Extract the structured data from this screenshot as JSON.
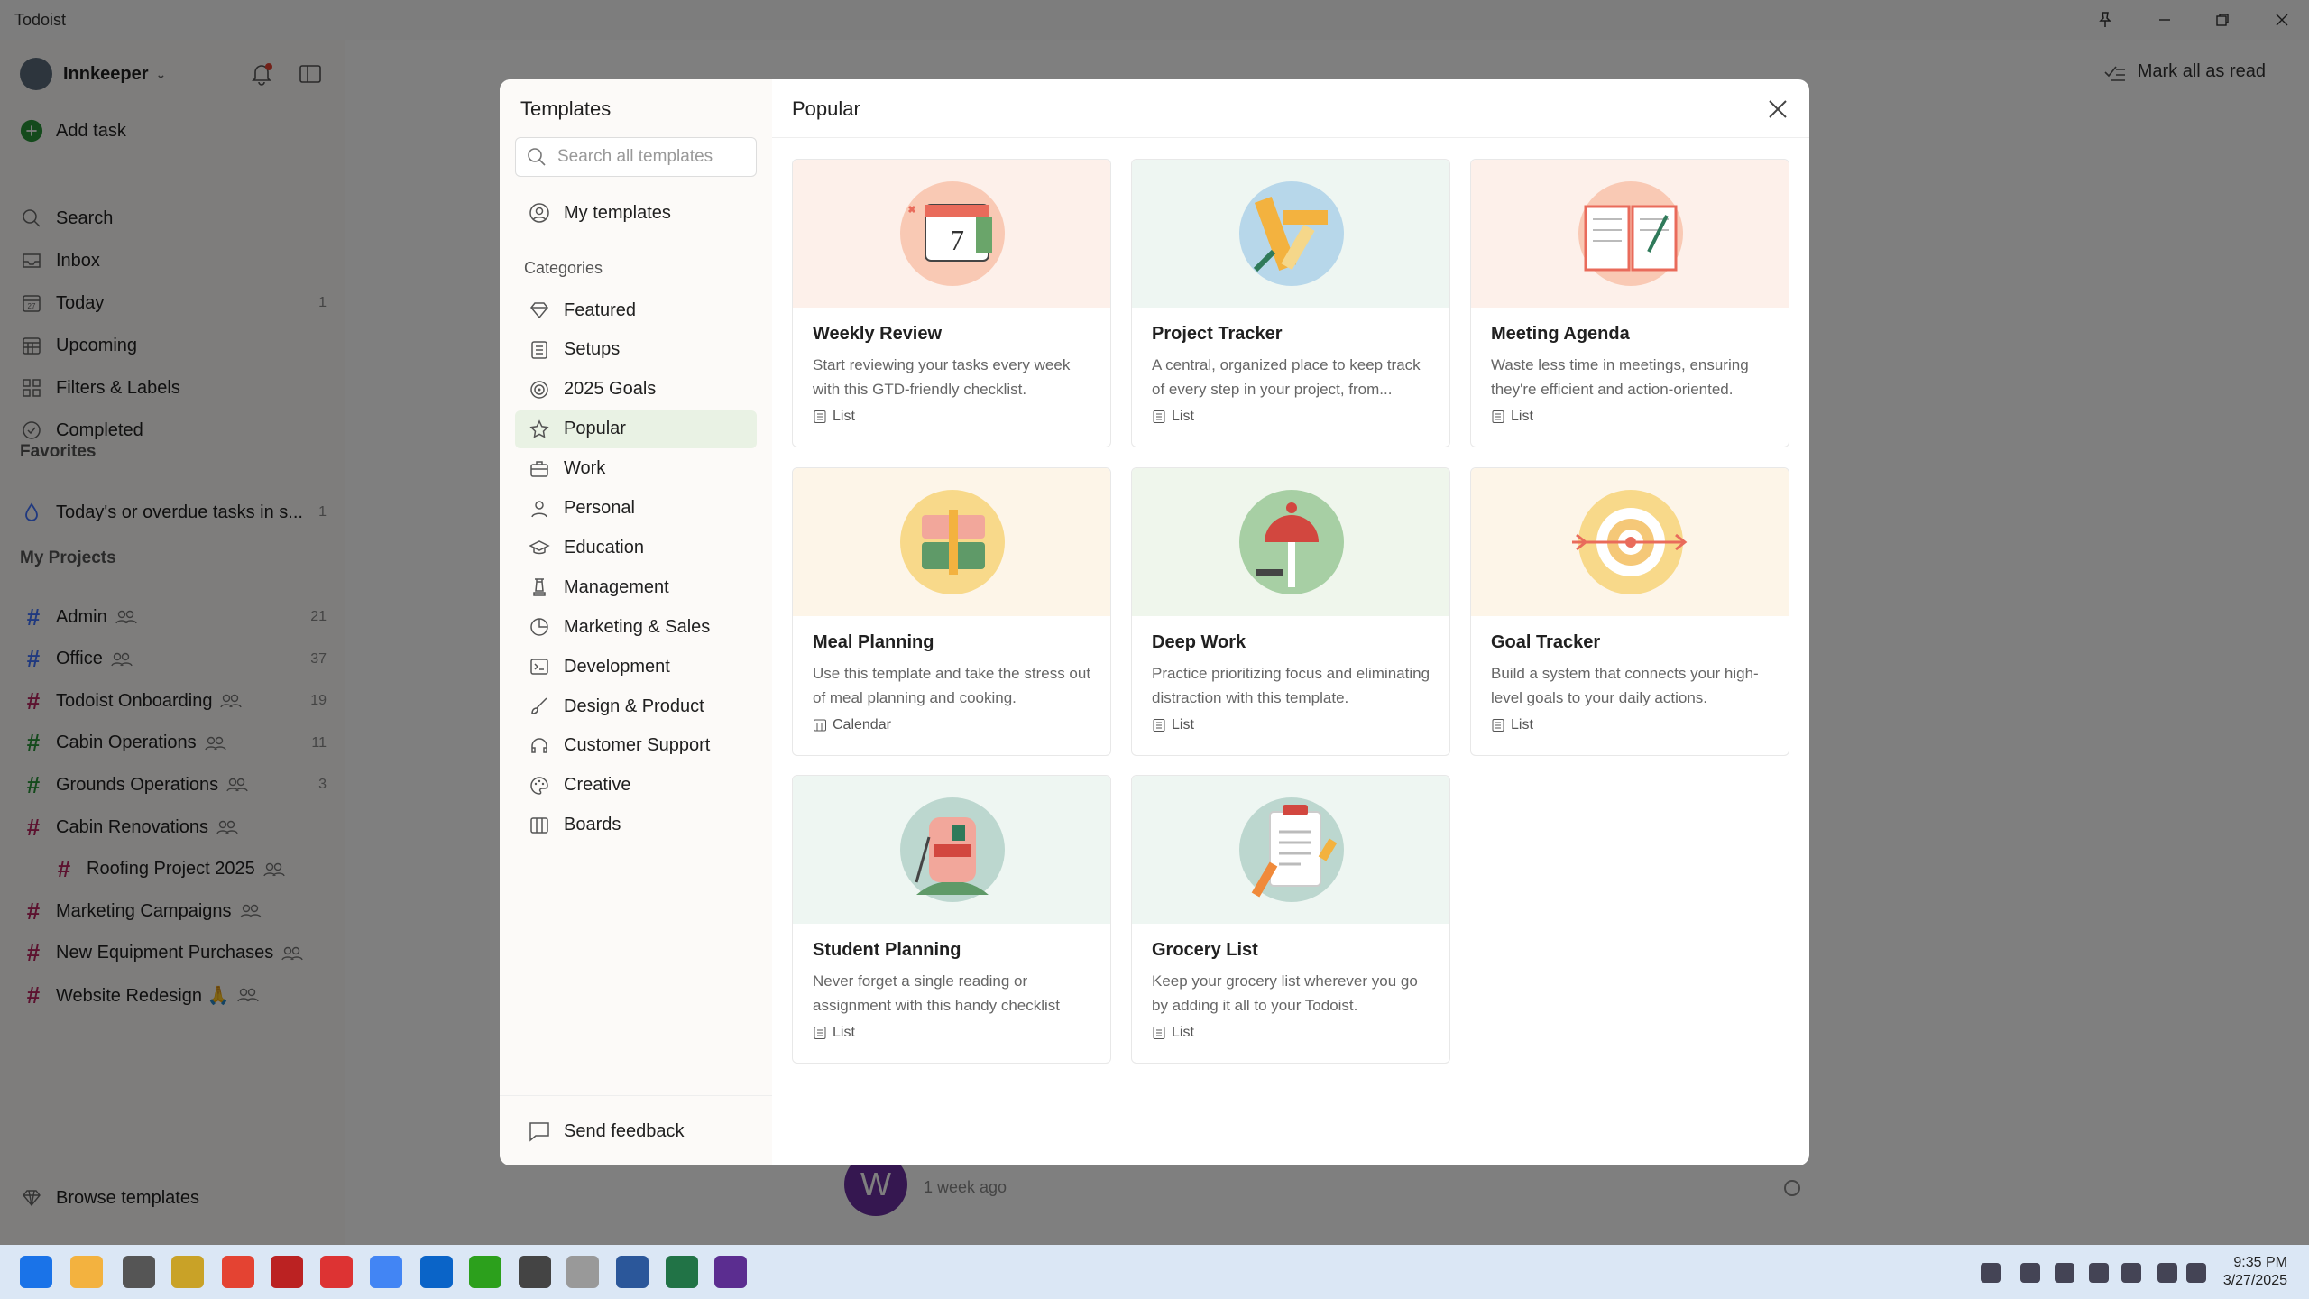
{
  "app": {
    "title": "Todoist"
  },
  "sidebar": {
    "user": "Innkeeper",
    "add_task": "Add task",
    "nav": [
      {
        "label": "Search",
        "icon": "search-icon",
        "count": ""
      },
      {
        "label": "Inbox",
        "icon": "inbox-icon",
        "count": ""
      },
      {
        "label": "Today",
        "icon": "calendar-today-icon",
        "count": "1"
      },
      {
        "label": "Upcoming",
        "icon": "calendar-grid-icon",
        "count": ""
      },
      {
        "label": "Filters & Labels",
        "icon": "filters-grid-icon",
        "count": ""
      },
      {
        "label": "Completed",
        "icon": "check-circle-icon",
        "count": ""
      }
    ],
    "favorites_heading": "Favorites",
    "favorites": [
      {
        "label": "Today's or overdue tasks in s...",
        "count": "1"
      }
    ],
    "projects_heading": "My Projects",
    "projects": [
      {
        "label": "Admin",
        "count": "21",
        "color": "#4073ff",
        "shared": true
      },
      {
        "label": "Office",
        "count": "37",
        "color": "#4073ff",
        "shared": true
      },
      {
        "label": "Todoist Onboarding",
        "count": "19",
        "color": "#b8255f",
        "shared": true
      },
      {
        "label": "Cabin Operations",
        "count": "11",
        "color": "#299438",
        "shared": true
      },
      {
        "label": "Grounds Operations",
        "count": "3",
        "color": "#299438",
        "shared": true
      },
      {
        "label": "Cabin Renovations",
        "count": "",
        "color": "#b8255f",
        "shared": true
      },
      {
        "label": "Roofing Project 2025",
        "count": "",
        "color": "#b8255f",
        "shared": true
      },
      {
        "label": "Marketing Campaigns",
        "count": "",
        "color": "#b8255f",
        "shared": true
      },
      {
        "label": "New Equipment Purchases",
        "count": "",
        "color": "#b8255f",
        "shared": true
      },
      {
        "label": "Website Redesign 🙏",
        "count": "",
        "color": "#b8255f",
        "shared": true
      }
    ],
    "browse_templates": "Browse templates"
  },
  "main": {
    "mark_all_read": "Mark all as read",
    "activity_time": "1 week ago",
    "avatar_letter": "W"
  },
  "modal": {
    "title": "Templates",
    "search_placeholder": "Search all templates",
    "my_templates": "My templates",
    "categories_heading": "Categories",
    "categories": [
      {
        "label": "Featured",
        "icon": "diamond-icon"
      },
      {
        "label": "Setups",
        "icon": "list-icon"
      },
      {
        "label": "2025 Goals",
        "icon": "target-icon"
      },
      {
        "label": "Popular",
        "icon": "star-icon",
        "active": true
      },
      {
        "label": "Work",
        "icon": "briefcase-icon"
      },
      {
        "label": "Personal",
        "icon": "person-icon"
      },
      {
        "label": "Education",
        "icon": "graduation-cap-icon"
      },
      {
        "label": "Management",
        "icon": "chess-icon"
      },
      {
        "label": "Marketing & Sales",
        "icon": "pie-chart-icon"
      },
      {
        "label": "Development",
        "icon": "terminal-icon"
      },
      {
        "label": "Design & Product",
        "icon": "brush-icon"
      },
      {
        "label": "Customer Support",
        "icon": "headset-icon"
      },
      {
        "label": "Creative",
        "icon": "palette-icon"
      },
      {
        "label": "Boards",
        "icon": "board-icon"
      }
    ],
    "send_feedback": "Send feedback",
    "section_title": "Popular",
    "templates": [
      {
        "title": "Weekly Review",
        "desc": "Start reviewing your tasks every week with this GTD-friendly checklist.",
        "type": "List",
        "bg": "#fdf0ea",
        "icon": "calendar-illustration"
      },
      {
        "title": "Project Tracker",
        "desc": "A central, organized place to keep track of every step in your project, from...",
        "type": "List",
        "bg": "#eef6f2",
        "icon": "ruler-pencil-illustration"
      },
      {
        "title": "Meeting Agenda",
        "desc": "Waste less time in meetings, ensuring they're efficient and action-oriented.",
        "type": "List",
        "bg": "#fdf0ea",
        "icon": "open-book-illustration"
      },
      {
        "title": "Meal Planning",
        "desc": "Use this template and take the stress out of meal planning and cooking.",
        "type": "Calendar",
        "bg": "#fdf5e8",
        "icon": "lunchbox-illustration"
      },
      {
        "title": "Deep Work",
        "desc": "Practice prioritizing focus and eliminating distraction with this template.",
        "type": "List",
        "bg": "#eff6ec",
        "icon": "desk-lamp-illustration"
      },
      {
        "title": "Goal Tracker",
        "desc": "Build a system that connects your high-level goals to your daily actions.",
        "type": "List",
        "bg": "#fdf5e8",
        "icon": "target-arrow-illustration"
      },
      {
        "title": "Student Planning",
        "desc": "Never forget a single reading or assignment with this handy checklist for...",
        "type": "List",
        "bg": "#eef6f2",
        "icon": "backpack-illustration"
      },
      {
        "title": "Grocery List",
        "desc": "Keep your grocery list wherever you go by adding it all to your Todoist.",
        "type": "List",
        "bg": "#eef6f2",
        "icon": "grocery-list-illustration"
      }
    ]
  },
  "taskbar": {
    "time": "9:35 PM",
    "date": "3/27/2025"
  }
}
